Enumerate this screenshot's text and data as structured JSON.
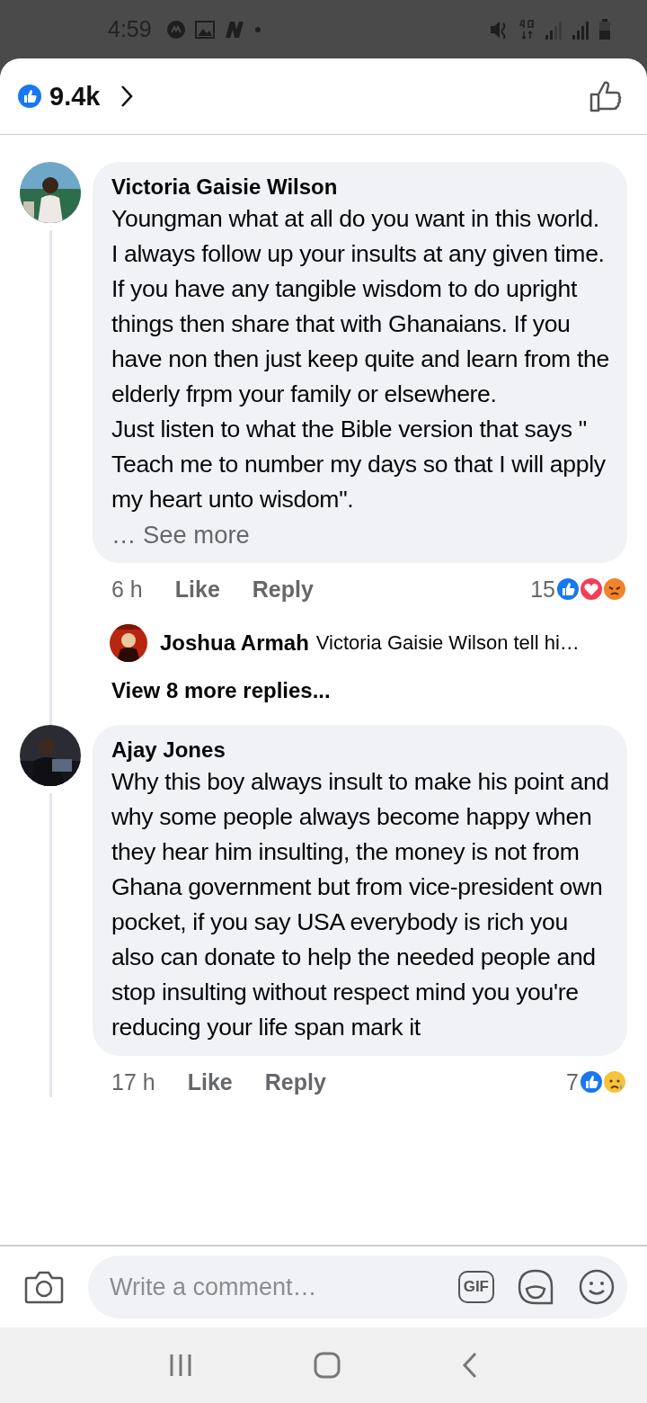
{
  "status_bar": {
    "time": "4:59"
  },
  "header": {
    "reaction_count": "9.4k"
  },
  "comments": [
    {
      "author": "Victoria Gaisie Wilson",
      "paragraphs": [
        "Youngman what at all do you want in this world. I always follow up your insults at any given time. If you have any tangible wisdom to do upright things then share that with Ghanaians. If you have non then just keep quite and learn from the elderly frpm your family or elsewhere.",
        "Just listen to what the Bible version that says \" Teach me to number my days so that I will apply my heart unto wisdom\"."
      ],
      "see_more": "… See more",
      "time": "6 h",
      "like": "Like",
      "reply": "Reply",
      "reaction_count": "15",
      "reactions": [
        {
          "kind": "like"
        },
        {
          "kind": "love"
        },
        {
          "kind": "angry"
        }
      ],
      "reply_preview": {
        "author": "Joshua Armah",
        "text": "Victoria Gaisie Wilson tell hi…"
      },
      "more_replies": "View 8 more replies..."
    },
    {
      "author": "Ajay Jones",
      "paragraphs": [
        "Why this boy always insult to make his point and why some people always become happy when they hear him insulting, the money is not from Ghana government but from vice-president own pocket, if you say USA  everybody is rich you also can donate to help the needed people and stop insulting without respect mind you you're reducing your life span mark it"
      ],
      "time": "17 h",
      "like": "Like",
      "reply": "Reply",
      "reaction_count": "7",
      "reactions": [
        {
          "kind": "like"
        },
        {
          "kind": "sad"
        }
      ]
    }
  ],
  "composer": {
    "placeholder": "Write a comment…",
    "gif": "GIF"
  }
}
